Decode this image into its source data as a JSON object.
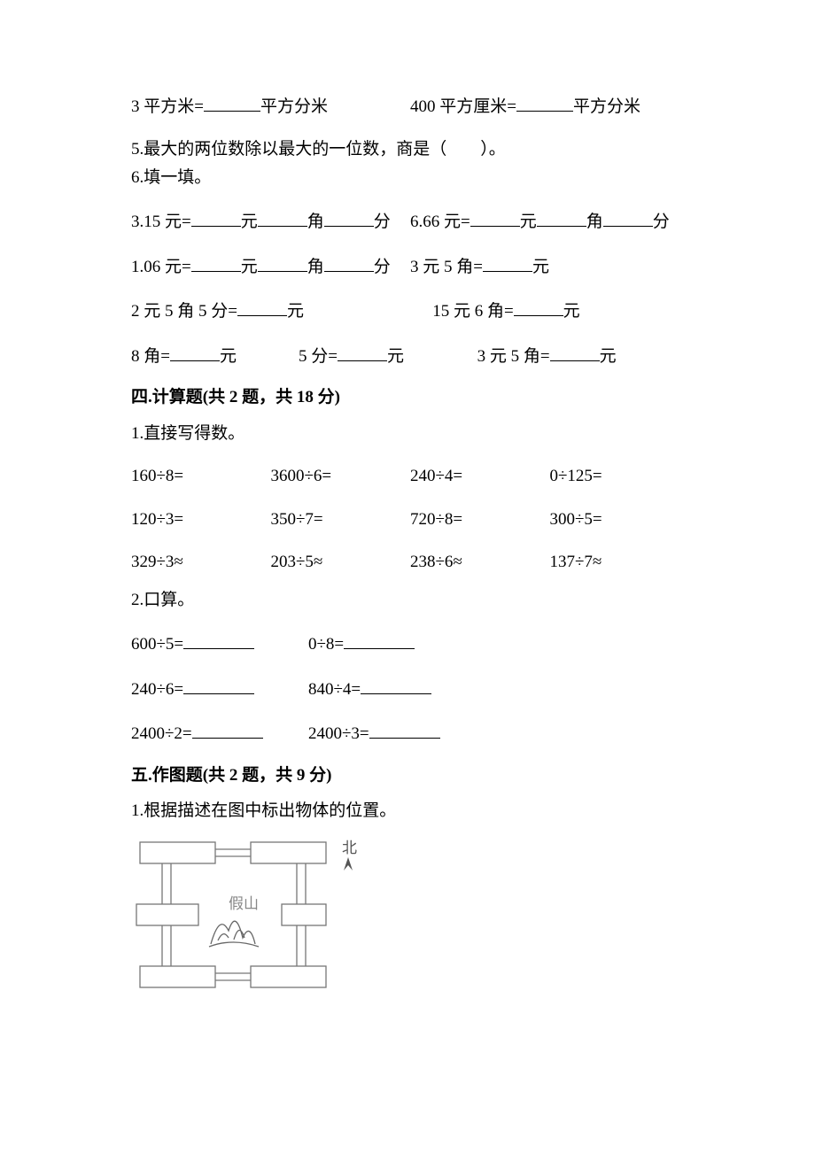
{
  "q4": {
    "left": {
      "pre": "3 平方米=",
      "post": "平方分米"
    },
    "right": {
      "pre": "400 平方厘米=",
      "post": "平方分米"
    }
  },
  "q5": "5.最大的两位数除以最大的一位数，商是（　　）。",
  "q6": {
    "title": "6.填一填。",
    "r1a": {
      "pre": "3.15 元=",
      "u1": "元",
      "u2": "角",
      "u3": "分"
    },
    "r1b": {
      "pre": "6.66 元=",
      "u1": "元",
      "u2": "角",
      "u3": "分"
    },
    "r2a": {
      "pre": "1.06 元=",
      "u1": "元",
      "u2": "角",
      "u3": "分"
    },
    "r2b": {
      "pre": "3 元 5 角=",
      "u1": "元"
    },
    "r3a": {
      "pre": "2 元 5 角 5 分=",
      "u1": "元"
    },
    "r3b": {
      "pre": "15 元 6 角=",
      "u1": "元"
    },
    "r4a": {
      "pre": "8 角=",
      "u1": "元"
    },
    "r4b": {
      "pre": "5 分=",
      "u1": "元"
    },
    "r4c": {
      "pre": "3 元 5 角=",
      "u1": "元"
    }
  },
  "s4": {
    "title": "四.计算题(共 2 题，共 18 分)",
    "q1": {
      "title": "1.直接写得数。",
      "rows": [
        [
          "160÷8=",
          "3600÷6=",
          "240÷4=",
          "0÷125="
        ],
        [
          "120÷3=",
          "350÷7=",
          "720÷8=",
          "300÷5="
        ],
        [
          "329÷3≈",
          "203÷5≈",
          "238÷6≈",
          "137÷7≈"
        ]
      ]
    },
    "q2": {
      "title": "2.口算。",
      "rows": [
        [
          "600÷5=",
          "0÷8="
        ],
        [
          "240÷6=",
          "840÷4="
        ],
        [
          "2400÷2=",
          "2400÷3="
        ]
      ]
    }
  },
  "s5": {
    "title": "五.作图题(共 2 题，共 9 分)",
    "q1": "1.根据描述在图中标出物体的位置。"
  },
  "figure": {
    "north": "北",
    "label": "假山"
  }
}
